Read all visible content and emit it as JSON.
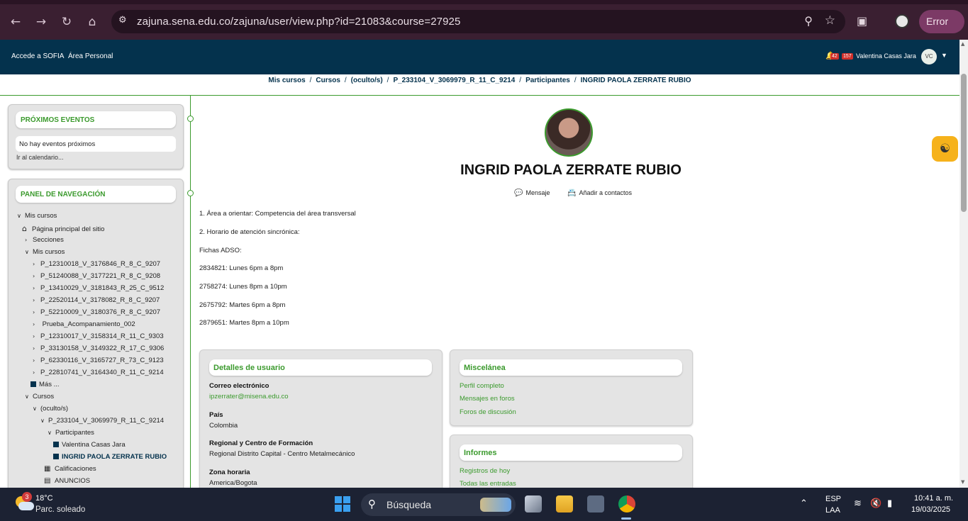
{
  "browser": {
    "url": "zajuna.sena.edu.co/zajuna/user/view.php?id=21083&course=27925",
    "error_label": "Error"
  },
  "navbar": {
    "links": [
      "Accede a SOFIA",
      "Área Personal"
    ],
    "notif_count": "42",
    "msg_count": "157",
    "user_name": "Valentina Casas Jara",
    "user_initials": "VC"
  },
  "breadcrumb": [
    "Mis cursos",
    "Cursos",
    "(oculto/s)",
    "P_233104_V_3069979_R_11_C_9214",
    "Participantes",
    "INGRID PAOLA ZERRATE RUBIO"
  ],
  "events_block": {
    "title": "PRÓXIMOS EVENTOS",
    "empty_text": "No hay eventos próximos",
    "calendar_link": "Ir al calendario..."
  },
  "nav_block": {
    "title": "PANEL DE NAVEGACIÓN",
    "items": [
      {
        "label": "Mis cursos",
        "icon": "chevron-down"
      },
      {
        "label": "Página principal del sitio",
        "icon": "home"
      },
      {
        "label": "Secciones",
        "icon": "chevron-right"
      },
      {
        "label": "Mis cursos",
        "icon": "chevron-down"
      },
      {
        "label": "P_12310018_V_3176846_R_8_C_9207",
        "icon": "chevron-right"
      },
      {
        "label": "P_51240088_V_3177221_R_8_C_9208",
        "icon": "chevron-right"
      },
      {
        "label": "P_13410029_V_3181843_R_25_C_9512",
        "icon": "chevron-right"
      },
      {
        "label": "P_22520114_V_3178082_R_8_C_9207",
        "icon": "chevron-right"
      },
      {
        "label": "P_52210009_V_3180376_R_8_C_9207",
        "icon": "chevron-right"
      },
      {
        "label": "Prueba_Acompanamiento_002",
        "icon": "chevron-right"
      },
      {
        "label": "P_12310017_V_3158314_R_11_C_9303",
        "icon": "chevron-right"
      },
      {
        "label": "P_33130158_V_3149322_R_17_C_9306",
        "icon": "chevron-right"
      },
      {
        "label": "P_62330116_V_3165727_R_73_C_9123",
        "icon": "chevron-right"
      },
      {
        "label": "P_22810741_V_3164340_R_11_C_9214",
        "icon": "chevron-right"
      },
      {
        "label": "Más ...",
        "icon": "square"
      },
      {
        "label": "Cursos",
        "icon": "chevron-down"
      },
      {
        "label": "(oculto/s)",
        "icon": "chevron-down"
      },
      {
        "label": "P_233104_V_3069979_R_11_C_9214",
        "icon": "chevron-down"
      },
      {
        "label": "Participantes",
        "icon": "chevron-down"
      },
      {
        "label": "Valentina Casas Jara",
        "icon": "square"
      },
      {
        "label": "INGRID PAOLA ZERRATE RUBIO",
        "icon": "square"
      },
      {
        "label": "Calificaciones",
        "icon": "table"
      },
      {
        "label": "ANUNCIOS",
        "icon": "forum"
      }
    ]
  },
  "profile": {
    "name": "INGRID PAOLA ZERRATE RUBIO",
    "message_label": "Mensaje",
    "add_contact_label": "Añadir a contactos",
    "description": [
      "1. Área a orientar: Competencia del área transversal",
      "2. Horario de atención sincrónica:",
      "Fichas ADSO:",
      "2834821: Lunes 6pm a 8pm",
      "2758274: Lunes 8pm a 10pm",
      "2675792: Martes 6pm a 8pm",
      "2879651: Martes 8pm a 10pm"
    ]
  },
  "user_details": {
    "title": "Detalles de usuario",
    "fields": [
      {
        "label": "Correo electrónico",
        "value": "ipzerrater@misena.edu.co"
      },
      {
        "label": "País",
        "value": "Colombia"
      },
      {
        "label": "Regional y Centro de Formación",
        "value": "Regional Distrito Capital - Centro Metalmecánico"
      },
      {
        "label": "Zona horaria",
        "value": "America/Bogota"
      }
    ]
  },
  "misc": {
    "title": "Miscelánea",
    "links": [
      "Perfil completo",
      "Mensajes en foros",
      "Foros de discusión"
    ]
  },
  "reports": {
    "title": "Informes",
    "links": [
      "Registros de hoy",
      "Todas las entradas"
    ]
  },
  "taskbar": {
    "weather_badge": "3",
    "temperature": "18°C",
    "condition": "Parc. soleado",
    "search_placeholder": "Búsqueda",
    "lang": "ESP",
    "layout": "LAA",
    "time": "10:41 a. m.",
    "date": "19/03/2025"
  },
  "colors": {
    "navbar": "#04324d",
    "accent_green": "#3b9a2d",
    "handshake_button": "#f6b21b"
  }
}
